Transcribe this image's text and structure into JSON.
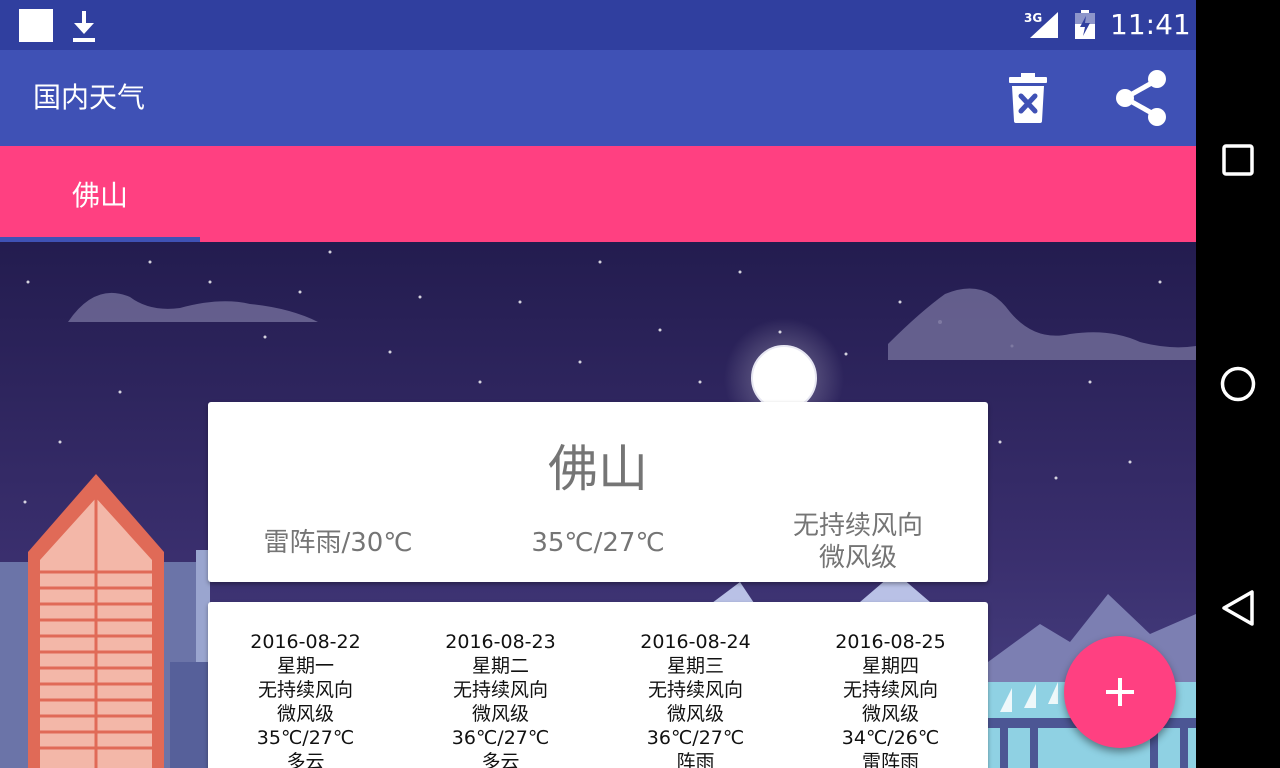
{
  "status_bar": {
    "time": "11:41",
    "network": "3G",
    "icons": [
      "notification-square-icon",
      "download-icon",
      "signal-3g-icon",
      "battery-charging-icon"
    ]
  },
  "app_bar": {
    "title": "国内天气",
    "actions": [
      "delete-icon",
      "share-icon"
    ]
  },
  "tabs": [
    {
      "label": "佛山",
      "selected": true
    }
  ],
  "current": {
    "city": "佛山",
    "weather": "雷阵雨/30℃",
    "temp_range": "35℃/27℃",
    "wind_direction": "无持续风向",
    "wind_level": "微风级"
  },
  "forecast": [
    {
      "date": "2016-08-22",
      "weekday": "星期一",
      "wind_direction": "无持续风向",
      "wind_level": "微风级",
      "temp": "35℃/27℃",
      "weather": "多云"
    },
    {
      "date": "2016-08-23",
      "weekday": "星期二",
      "wind_direction": "无持续风向",
      "wind_level": "微风级",
      "temp": "36℃/27℃",
      "weather": "多云"
    },
    {
      "date": "2016-08-24",
      "weekday": "星期三",
      "wind_direction": "无持续风向",
      "wind_level": "微风级",
      "temp": "36℃/27℃",
      "weather": "阵雨"
    },
    {
      "date": "2016-08-25",
      "weekday": "星期四",
      "wind_direction": "无持续风向",
      "wind_level": "微风级",
      "temp": "34℃/26℃",
      "weather": "雷阵雨"
    }
  ],
  "fab": {
    "icon": "add-icon"
  },
  "nav_bar": {
    "buttons": [
      "recents-icon",
      "home-icon",
      "back-icon"
    ]
  },
  "colors": {
    "status_bar": "#303f9f",
    "primary": "#3f51b5",
    "accent": "#ff4081",
    "sky": "#2b2359",
    "card_text": "#757575"
  }
}
